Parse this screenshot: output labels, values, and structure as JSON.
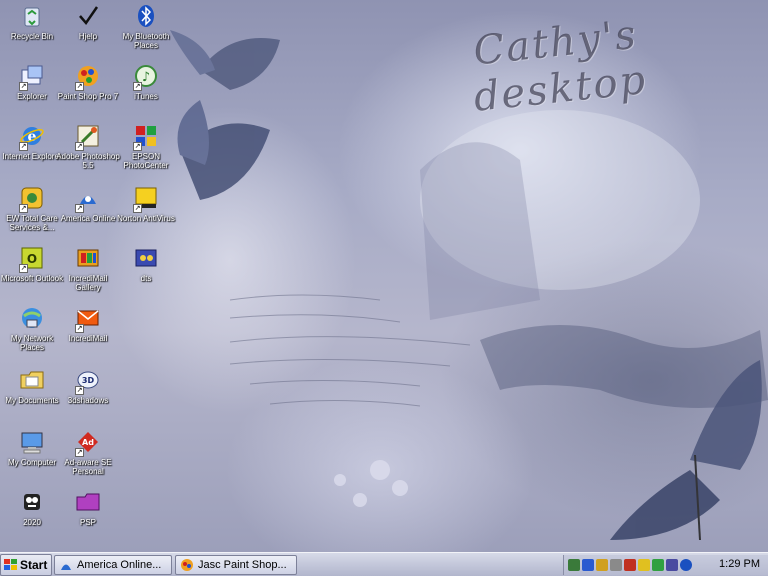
{
  "wallpaper": {
    "title": "Cathy's desktop"
  },
  "icons": [
    {
      "label": "Recycle Bin",
      "icon": "recycle-bin-icon"
    },
    {
      "label": "Explorer",
      "icon": "explorer-icon"
    },
    {
      "label": "Internet Explorer",
      "icon": "internet-explorer-icon"
    },
    {
      "label": "EW Total Care Services &...",
      "icon": "total-care-icon"
    },
    {
      "label": "Microsoft Outlook",
      "icon": "outlook-icon"
    },
    {
      "label": "My Network Places",
      "icon": "network-places-icon"
    },
    {
      "label": "My Documents",
      "icon": "my-documents-icon"
    },
    {
      "label": "My Computer",
      "icon": "my-computer-icon"
    },
    {
      "label": "2020",
      "icon": "folder-2020-icon"
    },
    {
      "label": "Hjelp",
      "icon": "checkmark-icon"
    },
    {
      "label": "Paint Shop Pro 7",
      "icon": "paint-shop-pro-icon"
    },
    {
      "label": "Adobe Photoshop 5.5",
      "icon": "photoshop-icon"
    },
    {
      "label": "America Online",
      "icon": "aol-icon"
    },
    {
      "label": "IncrediMail Gallery",
      "icon": "incredimail-gallery-icon"
    },
    {
      "label": "IncrediMail",
      "icon": "incredimail-icon"
    },
    {
      "label": "3dshadows",
      "icon": "3dshadows-icon"
    },
    {
      "label": "Ad-aware SE Personal",
      "icon": "ad-aware-icon"
    },
    {
      "label": "PSP",
      "icon": "psp-folder-icon"
    },
    {
      "label": "My Bluetooth Places",
      "icon": "bluetooth-icon"
    },
    {
      "label": "iTunes",
      "icon": "itunes-icon"
    },
    {
      "label": "EPSON PhotoCenter",
      "icon": "epson-icon"
    },
    {
      "label": "Norton AntiVirus",
      "icon": "norton-icon"
    },
    {
      "label": "dts",
      "icon": "dts-icon"
    }
  ],
  "taskbar": {
    "start_label": "Start",
    "tasks": [
      {
        "label": "America Online...",
        "icon": "aol-task-icon"
      },
      {
        "label": "Jasc Paint Shop...",
        "icon": "paint-shop-task-icon"
      }
    ],
    "clock": "1:29 PM",
    "tray_icons": [
      "tray-icon-1",
      "tray-icon-2",
      "tray-icon-3",
      "tray-icon-4",
      "tray-icon-5",
      "tray-icon-6",
      "tray-icon-7",
      "tray-icon-8",
      "bluetooth-tray-icon"
    ]
  }
}
